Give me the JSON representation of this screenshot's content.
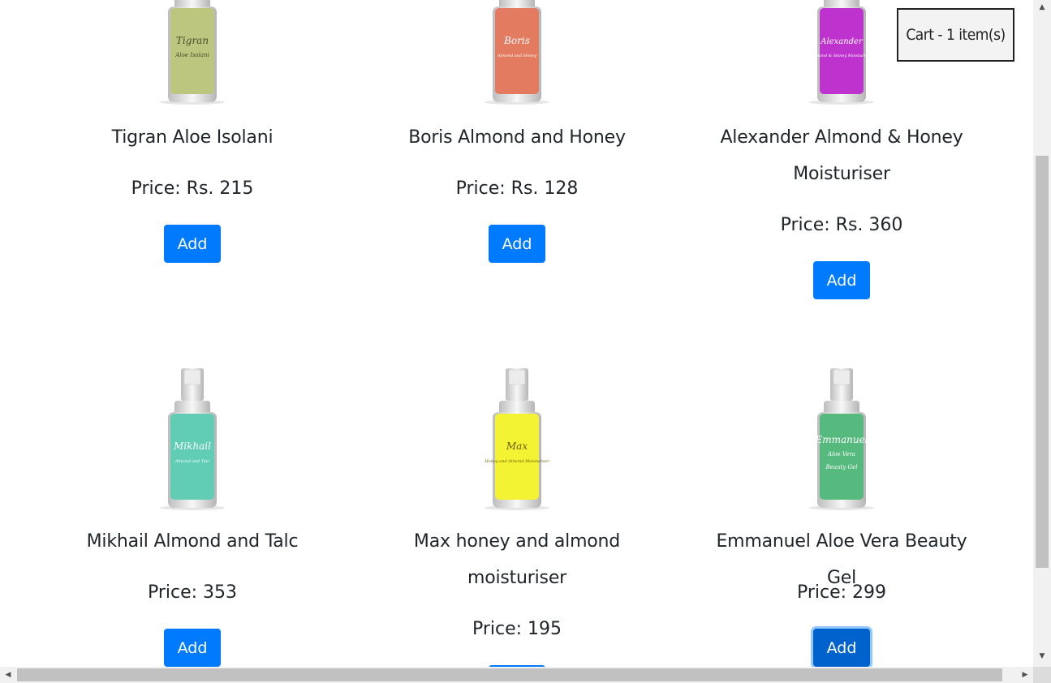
{
  "cart": {
    "label": "Cart - 1 item(s)"
  },
  "add_label": "Add",
  "products": [
    {
      "name": "Tigran Aloe Isolani",
      "price": "Price: Rs. 215",
      "bottle_color": "#b4bf6e",
      "label_lines": [
        "Tigran",
        "Aloe Isolani"
      ],
      "label_color": "#4a4a2a"
    },
    {
      "name": "Boris Almond and Honey",
      "price": "Price: Rs. 128",
      "bottle_color": "#e0694a",
      "label_lines": [
        "Boris",
        "Almond and Honey"
      ],
      "label_color": "#ffffff"
    },
    {
      "name": "Alexander Almond & Honey Moisturiser",
      "price": "Price: Rs. 360",
      "bottle_color": "#b517c8",
      "label_lines": [
        "Alexander",
        "Almond & Honey Moisturiser"
      ],
      "label_color": "#ffffff"
    },
    {
      "name": "Mikhail Almond and Talc",
      "price": "Price: 353",
      "bottle_color": "#4cc7ab",
      "label_lines": [
        "Mikhail",
        "Almond and Talc"
      ],
      "label_color": "#ffffff"
    },
    {
      "name": "Max honey and almond moisturiser",
      "price": "Price: 195",
      "bottle_color": "#f2f218",
      "label_lines": [
        "Max",
        "Honey and Almond Moisturiser"
      ],
      "label_color": "#6a5a00"
    },
    {
      "name": "Emmanuel Aloe Vera Beauty Gel",
      "price": "Price: 299",
      "bottle_color": "#3fb06c",
      "label_lines": [
        "Emmanuel",
        "Aloe Vera",
        "Beauty Gel"
      ],
      "label_color": "#ffffff"
    }
  ]
}
